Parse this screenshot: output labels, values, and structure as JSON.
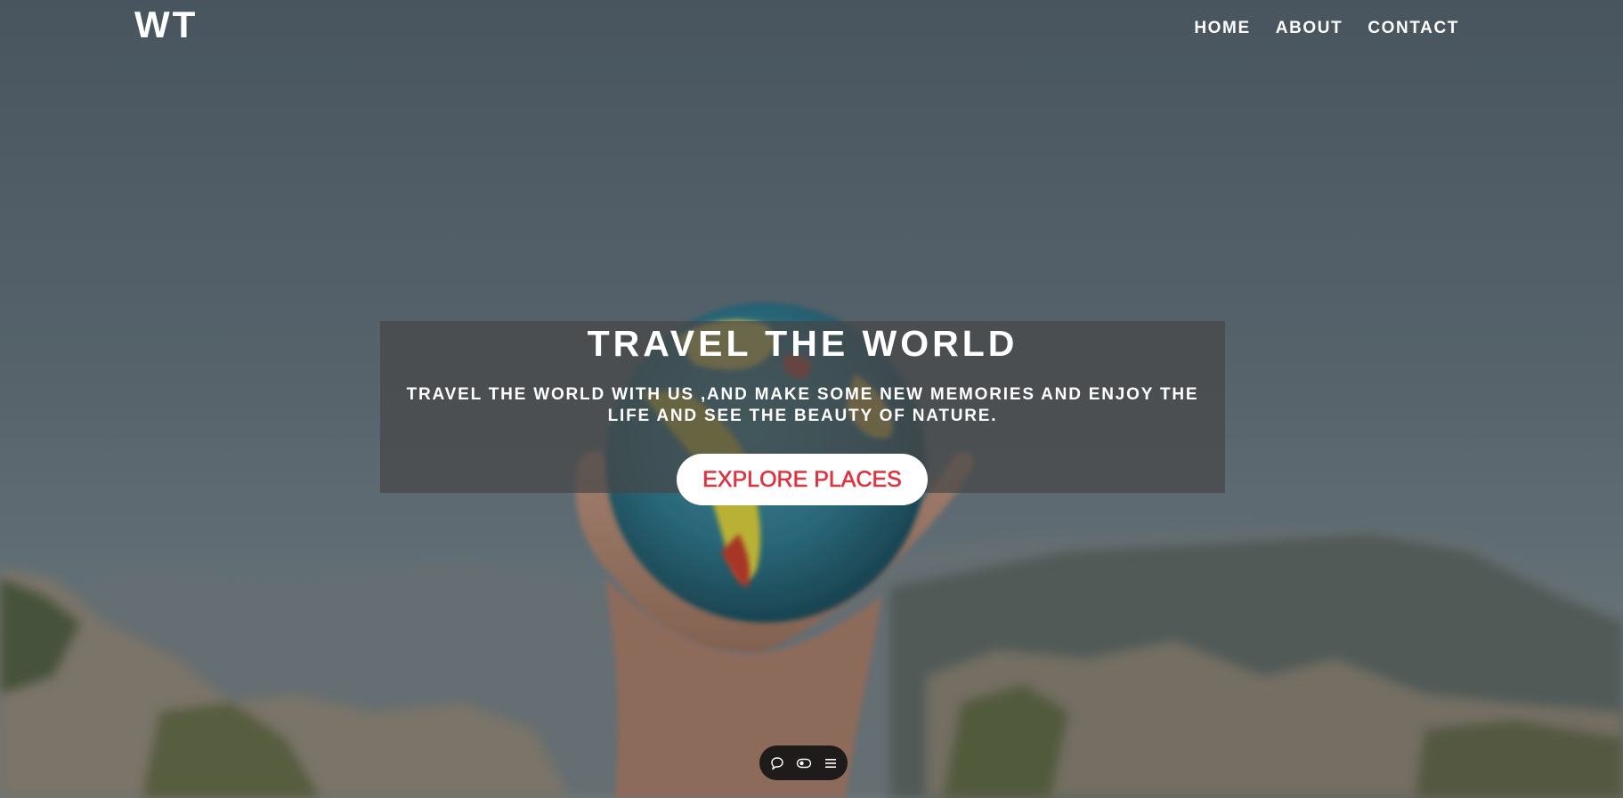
{
  "header": {
    "logo": "WT",
    "nav": [
      "HOME",
      "ABOUT",
      "CONTACT"
    ]
  },
  "hero": {
    "title": "TRAVEL THE WORLD",
    "subtitle": "TRAVEL THE WORLD WITH US ,AND MAKE SOME NEW MEMORIES AND ENJOY THE LIFE AND SEE THE BEAUTY OF NATURE.",
    "button_label": "EXPLORE PLACES"
  },
  "toolbar": {
    "icons": [
      "comment-icon",
      "toggle-icon",
      "menu-icon"
    ]
  },
  "colors": {
    "accent": "#e0313e",
    "text": "#ffffff",
    "hero_box": "#464646",
    "toolbar": "#1e1b1a"
  }
}
